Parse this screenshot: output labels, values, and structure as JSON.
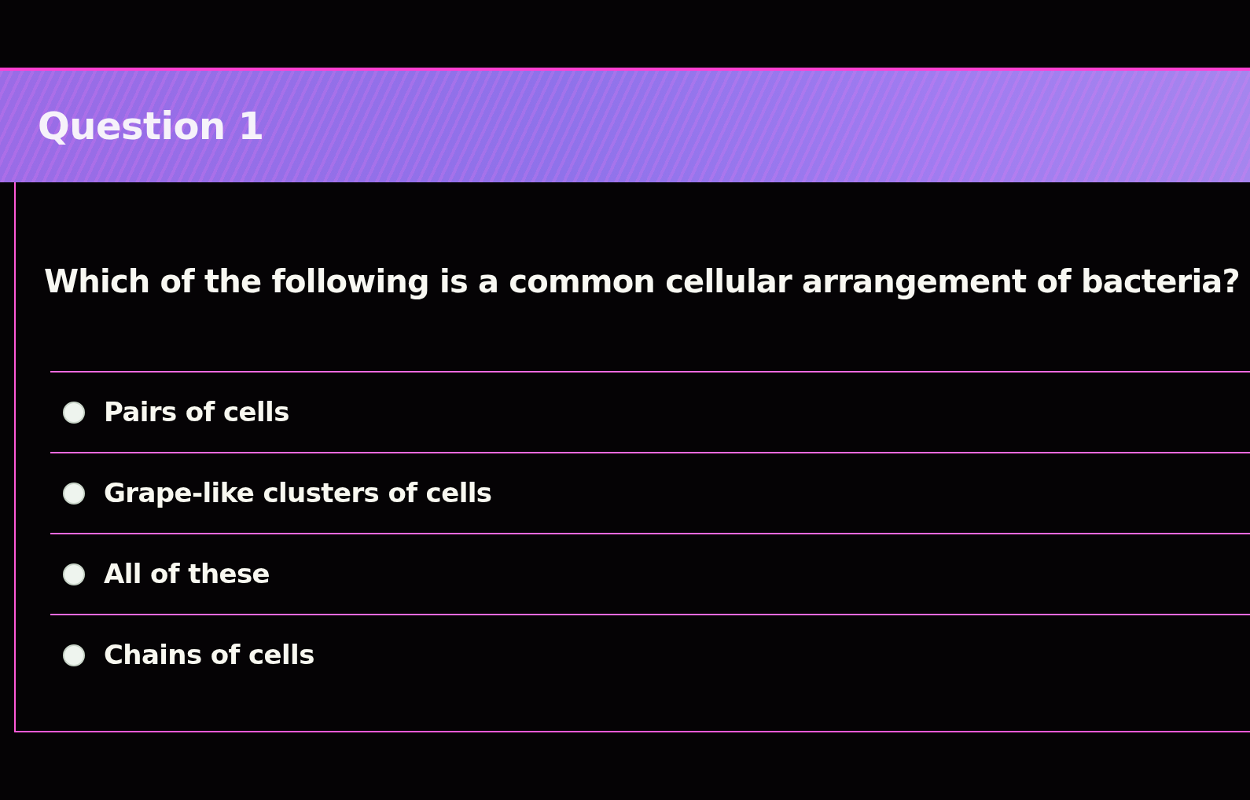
{
  "header": {
    "title": "Question 1"
  },
  "question": {
    "text": "Which of the following is a common cellular arrangement of bacteria?"
  },
  "options": [
    {
      "label": "Pairs of cells",
      "selected": false
    },
    {
      "label": "Grape-like clusters of cells",
      "selected": false
    },
    {
      "label": "All of these",
      "selected": false
    },
    {
      "label": "Chains of cells",
      "selected": false
    }
  ]
}
